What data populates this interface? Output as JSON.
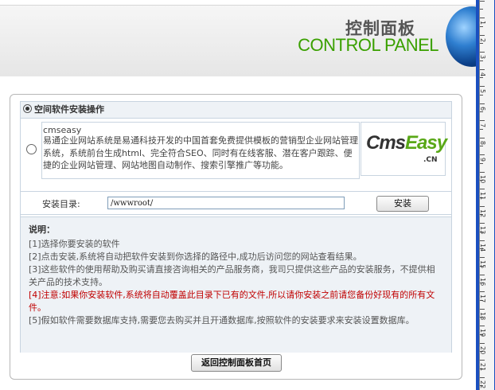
{
  "header": {
    "title_cn": "控制面板",
    "title_en": "CONTROL PANEL"
  },
  "ruler": {
    "labels": [
      "1",
      "2",
      "3",
      "4",
      "5",
      "6",
      "7",
      "8",
      "9",
      "10",
      "11",
      "12",
      "13",
      "14",
      "15",
      "16",
      "17",
      "18",
      "19",
      "20",
      "21",
      "22"
    ]
  },
  "section": {
    "title": "空间软件安装操作"
  },
  "software": {
    "name": "cmseasy",
    "description": "易通企业网站系统是易通科技开发的中国首套免费提供模板的营销型企业网站管理系统，系统前台生成html、完全符合SEO、同时有在线客服、潜在客户跟踪、便捷的企业网站管理、网站地图自动制作、搜索引擎推广等功能。",
    "logo_text_dark": "Cms",
    "logo_text_green": "Easy",
    "logo_sub": ".CN"
  },
  "install": {
    "dir_label": "安装目录:",
    "dir_value": "/wwwroot/",
    "button_label": "安装"
  },
  "notes": {
    "title": "说明：",
    "items": [
      "[1]选择你要安装的软件",
      "[2]点击安装,系统将自动把软件安装到你选择的路径中,成功后访问您的网站查看结果。",
      "[3]这些软件的使用帮助及购买请直接咨询相关的产品服务商，我司只提供这些产品的安装服务，不提供相关产品的技术支持。",
      "[4]注意:如果你安装软件,系统将自动覆盖此目录下已有的文件,所以请你安装之前请您备份好现有的所有文件。",
      "[5]假如软件需要数据库支持,需要您去购买并且开通数据库,按照软件的安装要求来安装设置数据库。"
    ]
  },
  "footer": {
    "back_label": "返回控制面板首页"
  },
  "colors": {
    "accent_green": "#3aa000",
    "warning_red": "#c00000",
    "panel_bg": "#eef2f6"
  }
}
